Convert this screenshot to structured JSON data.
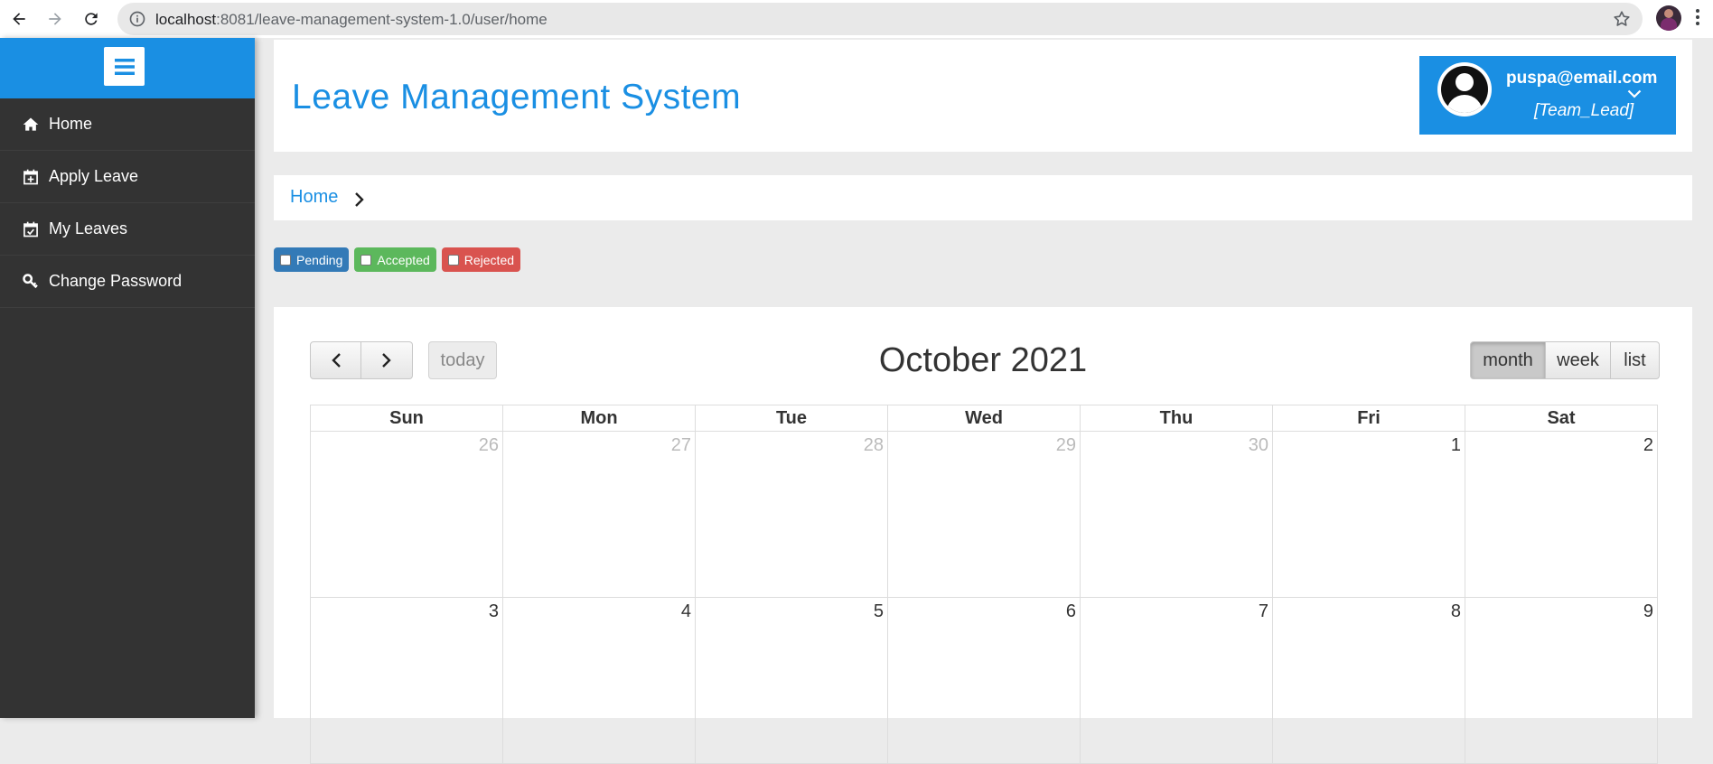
{
  "browser": {
    "url_host": "localhost",
    "url_rest": ":8081/leave-management-system-1.0/user/home"
  },
  "sidebar": {
    "items": [
      {
        "label": "Home",
        "icon": "home-icon"
      },
      {
        "label": "Apply Leave",
        "icon": "calendar-plus-icon"
      },
      {
        "label": "My Leaves",
        "icon": "calendar-check-icon"
      },
      {
        "label": "Change Password",
        "icon": "key-icon"
      }
    ]
  },
  "header": {
    "title": "Leave Management System",
    "user_email": "puspa@email.com",
    "user_role": "[Team_Lead]"
  },
  "breadcrumb": {
    "home": "Home"
  },
  "filters": [
    {
      "label": "Pending",
      "color": "#337ab7"
    },
    {
      "label": "Accepted",
      "color": "#5cb85c"
    },
    {
      "label": "Rejected",
      "color": "#d9534f"
    }
  ],
  "calendar": {
    "title": "October 2021",
    "today_label": "today",
    "views": [
      "month",
      "week",
      "list"
    ],
    "active_view": "month",
    "weekdays": [
      "Sun",
      "Mon",
      "Tue",
      "Wed",
      "Thu",
      "Fri",
      "Sat"
    ],
    "weeks": [
      [
        "26",
        "27",
        "28",
        "29",
        "30",
        "1",
        "2"
      ],
      [
        "3",
        "4",
        "5",
        "6",
        "7",
        "8",
        "9"
      ]
    ]
  },
  "colors": {
    "accent": "#1a8fe3",
    "sidebar_bg": "#333333"
  }
}
